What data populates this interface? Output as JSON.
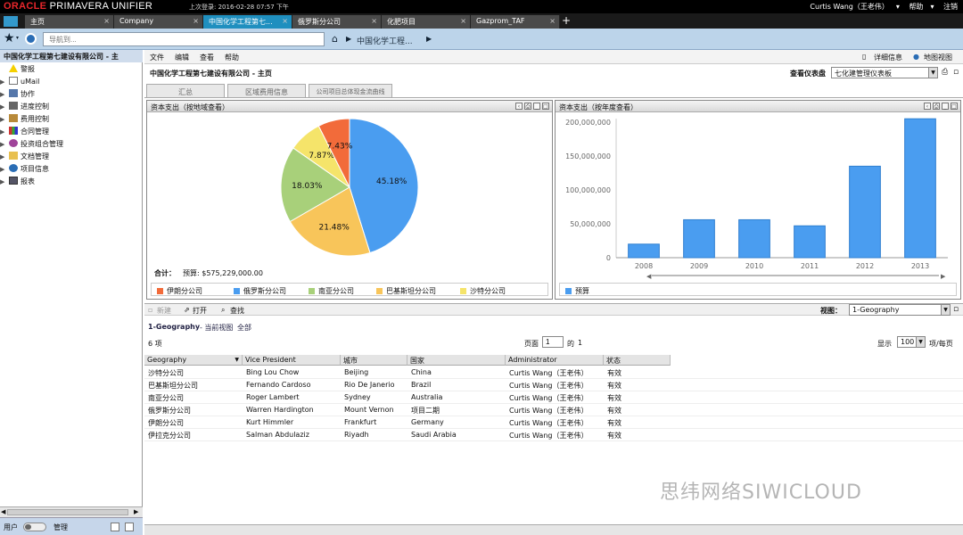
{
  "app": {
    "brand": "ORACLE",
    "product": "PRIMAVERA UNIFIER"
  },
  "header": {
    "last_login": "上次登录: 2016-02-28 07:57 下午",
    "user": "Curtis Wang（王老伟）",
    "help": "帮助",
    "logout": "注销"
  },
  "tabs": [
    {
      "label": "主页"
    },
    {
      "label": "Company"
    },
    {
      "label": "中国化学工程第七..."
    },
    {
      "label": "俄罗斯分公司"
    },
    {
      "label": "化肥项目"
    },
    {
      "label": "Gazprom_TAF"
    }
  ],
  "nav": {
    "placeholder": "导航到...",
    "breadcrumb": "中国化学工程..."
  },
  "sidebar": {
    "title": "中国化学工程第七建设有限公司 - 主",
    "items": [
      {
        "label": "警报"
      },
      {
        "label": "uMail"
      },
      {
        "label": "协作"
      },
      {
        "label": "进度控制"
      },
      {
        "label": "费用控制"
      },
      {
        "label": "合同管理"
      },
      {
        "label": "投资组合管理"
      },
      {
        "label": "文档管理"
      },
      {
        "label": "项目信息"
      },
      {
        "label": "报表"
      }
    ],
    "footer_user": "用户",
    "footer_admin": "管理"
  },
  "menu": {
    "file": "文件",
    "edit": "编辑",
    "view": "查看",
    "help": "帮助",
    "details": "详细信息",
    "map_view": "地图视图"
  },
  "page": {
    "title": "中国化学工程第七建设有限公司 - 主页",
    "dashboard_label": "查看仪表盘",
    "dashboard_value": "七化建管理仪表板"
  },
  "subtabs": [
    {
      "label": "汇总"
    },
    {
      "label": "区域费用信息"
    },
    {
      "label": "公司项目总体现金流曲线"
    }
  ],
  "pie_panel": {
    "title": "资本支出（按地域查看）",
    "total_label": "合计：",
    "total_value": "预算: $575,229,000.00"
  },
  "bar_panel": {
    "title": "资本支出（按年度查看）"
  },
  "chart_data": [
    {
      "type": "pie",
      "title": "资本支出（按地域查看）",
      "slices": [
        {
          "name": "俄罗斯分公司",
          "value": 45.18,
          "label": "45.18%",
          "color": "#4a9df0"
        },
        {
          "name": "巴基斯坦分公司",
          "value": 21.48,
          "label": "21.48%",
          "color": "#f8c55a"
        },
        {
          "name": "南亚分公司",
          "value": 18.03,
          "label": "18.03%",
          "color": "#a8d07a"
        },
        {
          "name": "沙特分公司",
          "value": 7.87,
          "label": "7.87%",
          "color": "#f5e46a"
        },
        {
          "name": "伊朗分公司",
          "value": 7.43,
          "label": "7.43%",
          "color": "#f26b3a"
        }
      ],
      "legend": [
        "伊朗分公司",
        "俄罗斯分公司",
        "南亚分公司",
        "巴基斯坦分公司",
        "沙特分公司"
      ]
    },
    {
      "type": "bar",
      "title": "资本支出（按年度查看）",
      "categories": [
        "2008",
        "2009",
        "2010",
        "2011",
        "2012",
        "2013"
      ],
      "series": [
        {
          "name": "预算",
          "values": [
            20000000,
            56000000,
            56000000,
            47000000,
            135000000,
            205000000
          ],
          "color": "#4a9df0"
        }
      ],
      "yticks": [
        "0",
        "50,000,000",
        "100,000,000",
        "150,000,000",
        "200,000,000"
      ],
      "ylim": [
        0,
        200000000
      ]
    }
  ],
  "toolbar": {
    "new": "新建",
    "open": "打开",
    "find": "查找",
    "view_label": "视图：",
    "view_value": "1-Geography"
  },
  "list": {
    "view_name": "1-Geography",
    "current_view": "- 当前视图",
    "all": "全部",
    "count": "6 项",
    "page_label": "页面",
    "page_value": "1",
    "of": "的",
    "total_pages": "1",
    "show_label": "显示",
    "show_value": "100",
    "per_page": "项/每页"
  },
  "grid": {
    "columns": [
      "Geography",
      "Vice President",
      "城市",
      "国家",
      "Administrator",
      "状态"
    ],
    "rows": [
      [
        "沙特分公司",
        "Bing Lou Chow",
        "Beijing",
        "China",
        "Curtis Wang（王老伟）",
        "有效"
      ],
      [
        "巴基斯坦分公司",
        "Fernando Cardoso",
        "Rio De Janerio",
        "Brazil",
        "Curtis Wang（王老伟）",
        "有效"
      ],
      [
        "南亚分公司",
        "Roger Lambert",
        "Sydney",
        "Australia",
        "Curtis Wang（王老伟）",
        "有效"
      ],
      [
        "俄罗斯分公司",
        "Warren Hardington",
        "Mount Vernon",
        "项目二期",
        "Curtis Wang（王老伟）",
        "有效"
      ],
      [
        "伊朗分公司",
        "Kurt Himmler",
        "Frankfurt",
        "Germany",
        "Curtis Wang（王老伟）",
        "有效"
      ],
      [
        "伊拉克分公司",
        "Salman Abdulaziz",
        "Riyadh",
        "Saudi Arabia",
        "Curtis Wang（王老伟）",
        "有效"
      ]
    ]
  },
  "watermark": "思纬网络SIWICLOUD"
}
